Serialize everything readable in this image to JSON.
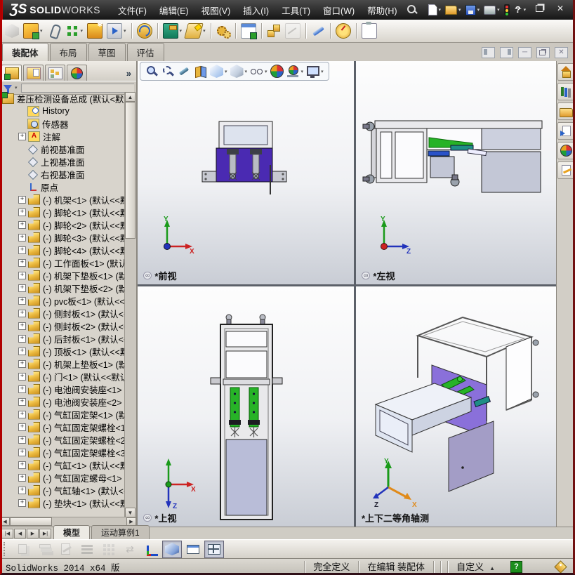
{
  "titlebar": {
    "logo_mark": "ƷS",
    "logo_solid": "SOLID",
    "logo_works": "WORKS",
    "menus": [
      "文件(F)",
      "编辑(E)",
      "视图(V)",
      "插入(I)",
      "工具(T)",
      "窗口(W)",
      "帮助(H)"
    ],
    "quick": [
      {
        "name": "new-document",
        "icon": "newdoc",
        "dd": true
      },
      {
        "name": "open-document",
        "icon": "openfold",
        "dd": true
      },
      {
        "name": "save",
        "icon": "disk",
        "dd": true
      },
      {
        "name": "print",
        "icon": "printer",
        "dd": true
      },
      {
        "name": "options",
        "icon": "traffic"
      },
      {
        "name": "help",
        "icon": "qmark",
        "dd": true
      }
    ],
    "window_buttons": [
      "minimize",
      "restore",
      "close"
    ]
  },
  "toolbar": {
    "items": [
      {
        "name": "edit-component",
        "icon": "cube-gray",
        "disabled": true
      },
      {
        "name": "insert-component",
        "icon": "insert",
        "dd": true
      },
      {
        "name": "mate",
        "icon": "clip"
      },
      {
        "name": "linear-component-pattern",
        "icon": "pattern",
        "dd": true
      },
      {
        "name": "smart-fasteners",
        "icon": "fastener"
      },
      {
        "name": "move-component",
        "icon": "move",
        "dd": true
      },
      {
        "name": "show-hidden-components",
        "icon": "hidden",
        "sep": true
      },
      {
        "name": "assembly-features",
        "icon": "hammer",
        "dd": true,
        "sep": true
      },
      {
        "name": "reference-geometry",
        "icon": "refgeo",
        "dd": true
      },
      {
        "name": "new-motion-study",
        "icon": "gears",
        "sep": true
      },
      {
        "name": "bill-of-materials",
        "icon": "bom",
        "sep": true
      },
      {
        "name": "exploded-view",
        "icon": "explode",
        "sep": true
      },
      {
        "name": "explode-line-sketch",
        "icon": "lines",
        "disabled": true
      },
      {
        "name": "instant3d",
        "icon": "pencil-blue",
        "sep": true
      },
      {
        "name": "large-assembly-mode",
        "icon": "radar",
        "sep": true
      },
      {
        "name": "take-snapshot",
        "icon": "clipboard",
        "sep": true
      }
    ]
  },
  "commandmanager": {
    "tabs": [
      {
        "label": "装配体",
        "active": true
      },
      {
        "label": "布局",
        "active": false
      },
      {
        "label": "草图",
        "active": false
      },
      {
        "label": "评估",
        "active": false
      }
    ]
  },
  "docwindow": {
    "buttons": [
      "tile-left",
      "tile-right",
      "minimize",
      "restore",
      "close"
    ]
  },
  "featuremanager": {
    "tabs": [
      {
        "name": "featuremanager-tree",
        "icon": "fm",
        "active": true
      },
      {
        "name": "propertymanager",
        "icon": "pm",
        "active": false
      },
      {
        "name": "configurationmanager",
        "icon": "cm",
        "active": false
      },
      {
        "name": "displaymanager",
        "icon": "dm",
        "active": false
      }
    ],
    "expand_label": "»"
  },
  "tree": {
    "root": "差压检测设备总成 (默认<默",
    "items": [
      {
        "icon": "history",
        "label": "History"
      },
      {
        "icon": "sensor",
        "label": "传感器"
      },
      {
        "icon": "annotation",
        "label": "注解",
        "expander": true
      },
      {
        "icon": "plane",
        "label": "前视基准面"
      },
      {
        "icon": "plane",
        "label": "上视基准面"
      },
      {
        "icon": "plane",
        "label": "右视基准面"
      },
      {
        "icon": "origin",
        "label": "原点"
      },
      {
        "icon": "part",
        "label": "(-) 机架<1> (默认<<默认",
        "expander": true
      },
      {
        "icon": "part",
        "label": "(-) 脚轮<1> (默认<<默认",
        "expander": true
      },
      {
        "icon": "part",
        "label": "(-) 脚轮<2> (默认<<默认",
        "expander": true
      },
      {
        "icon": "part",
        "label": "(-) 脚轮<3> (默认<<默认",
        "expander": true
      },
      {
        "icon": "part",
        "label": "(-) 脚轮<4> (默认<<默认",
        "expander": true
      },
      {
        "icon": "part",
        "label": "(-) 工作面板<1> (默认<<",
        "expander": true
      },
      {
        "icon": "part",
        "label": "(-) 机架下垫板<1> (默认",
        "expander": true
      },
      {
        "icon": "part",
        "label": "(-) 机架下垫板<2> (默认",
        "expander": true
      },
      {
        "icon": "part",
        "label": "(-) pvc板<1> (默认<<默认",
        "expander": true
      },
      {
        "icon": "part",
        "label": "(-) 侧封板<1> (默认<<默",
        "expander": true
      },
      {
        "icon": "part",
        "label": "(-) 侧封板<2> (默认<<默",
        "expander": true
      },
      {
        "icon": "part",
        "label": "(-) 后封板<1> (默认<<默",
        "expander": true
      },
      {
        "icon": "part",
        "label": "(-) 顶板<1> (默认<<默认",
        "expander": true
      },
      {
        "icon": "part",
        "label": "(-) 机架上垫板<1> (默认",
        "expander": true
      },
      {
        "icon": "part",
        "label": "(-) 门<1> (默认<<默认>_",
        "expander": true
      },
      {
        "icon": "part",
        "label": "(-) 电池阀安装座<1> (默",
        "expander": true
      },
      {
        "icon": "part",
        "label": "(-) 电池阀安装座<2> (默",
        "expander": true
      },
      {
        "icon": "part",
        "label": "(-) 气缸固定架<1> (默认",
        "expander": true
      },
      {
        "icon": "part",
        "label": "(-) 气缸固定架螺栓<1> (",
        "expander": true
      },
      {
        "icon": "part",
        "label": "(-) 气缸固定架螺栓<2> (",
        "expander": true
      },
      {
        "icon": "part",
        "label": "(-) 气缸固定架螺栓<3> (",
        "expander": true
      },
      {
        "icon": "part",
        "label": "(-) 气缸<1> (默认<<默认",
        "expander": true
      },
      {
        "icon": "part",
        "label": "(-) 气缸固定螺母<1> (默",
        "expander": true
      },
      {
        "icon": "part",
        "label": "(-) 气缸轴<1> (默认<<默",
        "expander": true
      },
      {
        "icon": "part",
        "label": "(-) 垫块<1> (默认<<默认",
        "expander": true
      }
    ]
  },
  "headsup": {
    "items": [
      {
        "name": "zoom-to-fit",
        "icon": "zoomfit"
      },
      {
        "name": "zoom-to-area",
        "icon": "zoomarea"
      },
      {
        "name": "previous-view",
        "icon": "prevview"
      },
      {
        "name": "section-view",
        "icon": "section"
      },
      {
        "name": "view-orientation",
        "icon": "vcube",
        "dd": true
      },
      {
        "name": "display-style",
        "icon": "dcube",
        "dd": true
      },
      {
        "name": "hide-show-items",
        "icon": "glasses",
        "dd": true
      },
      {
        "name": "edit-appearance",
        "icon": "ball"
      },
      {
        "name": "apply-scene",
        "icon": "scene",
        "dd": true
      },
      {
        "name": "view-settings",
        "icon": "monitor",
        "dd": true
      }
    ]
  },
  "viewports": [
    {
      "label": "*前视",
      "linked": true
    },
    {
      "label": "*左视",
      "linked": true
    },
    {
      "label": "*上视",
      "linked": true
    },
    {
      "label": "*上下二等角轴测",
      "linked": false
    }
  ],
  "taskpane": {
    "items": [
      {
        "name": "solidworks-resources",
        "icon": "home"
      },
      {
        "name": "design-library",
        "icon": "books"
      },
      {
        "name": "file-explorer",
        "icon": "folder"
      },
      {
        "name": "view-palette",
        "icon": "palette"
      },
      {
        "name": "appearances-scenes",
        "icon": "ball"
      },
      {
        "name": "custom-properties",
        "icon": "note"
      }
    ]
  },
  "motion": {
    "nav": [
      "first",
      "previous",
      "next",
      "last"
    ],
    "tabs": [
      {
        "label": "模型",
        "active": true
      },
      {
        "label": "运动算例1",
        "active": false
      }
    ]
  },
  "viewtoolbar": {
    "items": [
      {
        "name": "filter-graphics",
        "icon": "sheets",
        "disabled": true
      },
      {
        "name": "layer-properties",
        "icon": "layers",
        "disabled": true
      },
      {
        "name": "edit-annotations",
        "icon": "pensheet",
        "disabled": true
      },
      {
        "name": "line-format",
        "icon": "lines2",
        "disabled": true
      },
      {
        "name": "grid-settings",
        "icon": "gridfade",
        "disabled": true
      },
      {
        "name": "sync-views",
        "icon": "sync",
        "disabled": true
      },
      {
        "name": "axes-display",
        "icon": "axis"
      },
      {
        "name": "shaded-3d-view",
        "icon": "cube3d",
        "pressed": true
      },
      {
        "name": "single-view",
        "icon": "singleview"
      },
      {
        "name": "four-view",
        "icon": "fourview",
        "pressed": true
      }
    ]
  },
  "statusbar": {
    "left": "SolidWorks 2014 x64 版",
    "define_state": "完全定义",
    "edit_state": "在编辑 装配体",
    "units": "自定义",
    "help": "?"
  },
  "colors": {
    "model_purple": "#4a2ab2",
    "model_green": "#27b327",
    "panel_lavender": "#b9bdd6",
    "titlebar_red": "#c00000"
  }
}
